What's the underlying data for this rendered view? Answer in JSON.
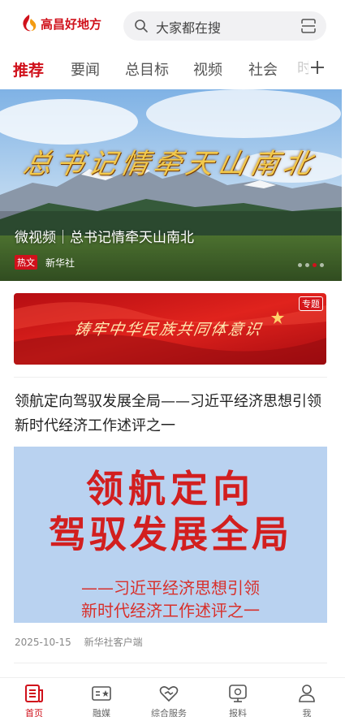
{
  "app": {
    "name": "高昌好地方",
    "brand_color": "#d0111b"
  },
  "search": {
    "placeholder": "大家都在搜",
    "search_icon": "search-icon",
    "scan_icon": "scan-icon"
  },
  "tabs": [
    {
      "label": "推荐",
      "active": true
    },
    {
      "label": "要闻",
      "active": false
    },
    {
      "label": "总目标",
      "active": false
    },
    {
      "label": "视频",
      "active": false
    },
    {
      "label": "社会",
      "active": false
    }
  ],
  "tabs_overflow_hint": "时",
  "hero": {
    "calligraphy": "总书记情牵天山南北",
    "title": "微视频｜总书记情牵天山南北",
    "badge": "热文",
    "source": "新华社",
    "dot_count": 4,
    "active_dot": 3
  },
  "banner": {
    "text": "铸牢中华民族共同体意识",
    "badge": "专题"
  },
  "article": {
    "title": "领航定向驾驭发展全局——习近平经济思想引领新时代经济工作述评之一",
    "image_lines": [
      "领航定向",
      "驾驭发展全局",
      "——习近平经济思想引领",
      "新时代经济工作述评之一"
    ],
    "date": "2025-10-15",
    "source": "新华社客户端"
  },
  "bottom_nav": [
    {
      "label": "首页",
      "icon": "home-news-icon",
      "active": true
    },
    {
      "label": "融媒",
      "icon": "media-icon",
      "active": false
    },
    {
      "label": "综合服务",
      "icon": "services-heart-icon",
      "active": false
    },
    {
      "label": "报料",
      "icon": "report-icon",
      "active": false
    },
    {
      "label": "我",
      "icon": "profile-icon",
      "active": false
    }
  ]
}
